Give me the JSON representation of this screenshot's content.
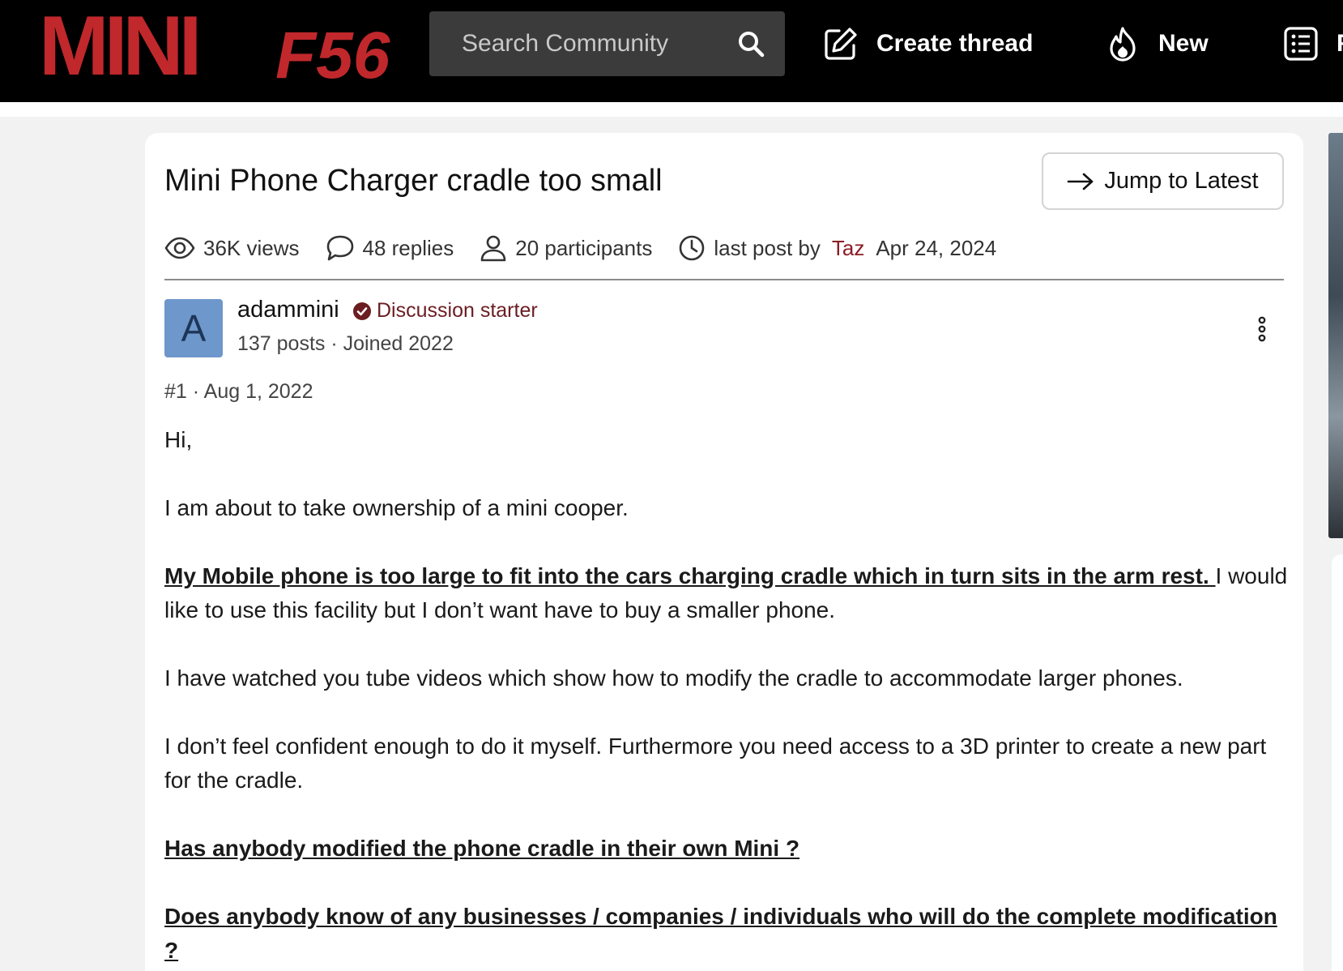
{
  "header": {
    "logo_text_main": "MINI",
    "logo_text_model": "F56",
    "search_placeholder": "Search Community",
    "nav": [
      {
        "label": "Create thread",
        "icon": "pencil-square-icon"
      },
      {
        "label": "New",
        "icon": "flame-icon"
      },
      {
        "label": "F",
        "icon": "list-icon"
      }
    ],
    "colors": {
      "bar": "#000000",
      "logo_red": "#c0282c"
    }
  },
  "thread": {
    "title": "Mini Phone Charger cradle too small",
    "jump_label": "Jump to Latest",
    "stats": {
      "views": "36K views",
      "replies": "48 replies",
      "participants": "20 participants",
      "last_post_prefix": "last post by",
      "last_post_user": "Taz",
      "last_post_date": "Apr 24, 2024"
    }
  },
  "post": {
    "avatar_letter": "A",
    "username": "adammini",
    "badge": "Discussion starter",
    "user_meta": "137 posts · Joined 2022",
    "meta": "#1 · Aug 1, 2022",
    "greeting": "Hi,",
    "p1": "I am about to take ownership of a mini cooper.",
    "p2_bold": "My Mobile phone is too large to fit into the cars charging cradle which in turn sits in the arm rest. ",
    "p2_rest": "I would like to use this facility but I don’t want have to buy a smaller phone.",
    "p3": "I have watched you tube videos which show how to modify the cradle to accommodate larger phones.",
    "p4": "I don’t feel confident enough to do it myself. Furthermore you need access to a 3D printer to create a new part for the cradle.",
    "q1": "Has anybody modified the phone cradle in their own Mini ?",
    "q2": "Does anybody know of any businesses / companies / individuals who will do the complete modification ?"
  }
}
